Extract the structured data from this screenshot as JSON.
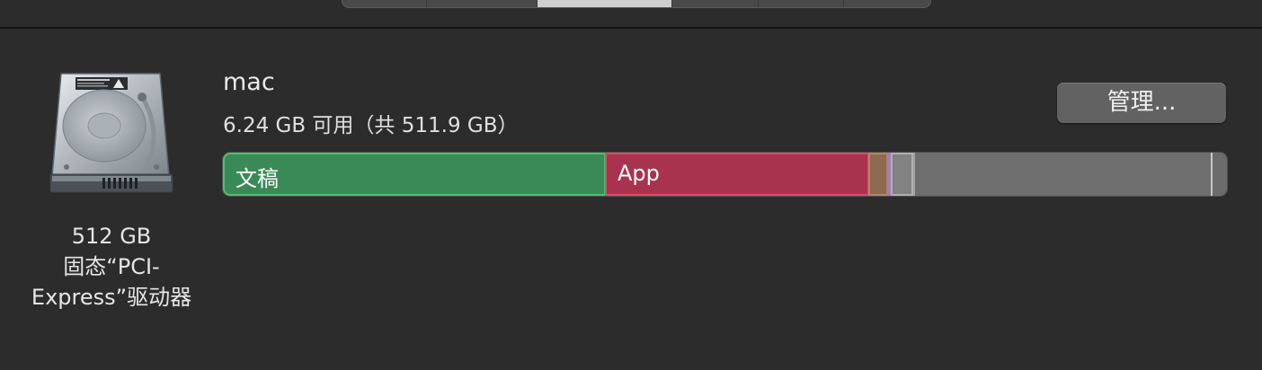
{
  "volume": {
    "name": "mac",
    "capacity_text": "6.24 GB 可用（共 511.9 GB）"
  },
  "drive": {
    "icon": "hard-drive-icon",
    "caption_line1": "512 GB",
    "caption_line2": "固态“PCI-",
    "caption_line3": "Express”驱动器"
  },
  "manage_button_label": "管理...",
  "storage_bar": {
    "segments": [
      {
        "label": "文稿",
        "color": "#3a8a57"
      },
      {
        "label": "App",
        "color": "#a8334f"
      },
      {
        "label": "",
        "color": "#8e6a50"
      },
      {
        "label": "",
        "color": "#a080c0"
      },
      {
        "label": "",
        "color": "#828282"
      },
      {
        "label": "",
        "color": "#6e6e6e"
      }
    ]
  },
  "tabs": {
    "count": 7,
    "selected_index": 2
  }
}
